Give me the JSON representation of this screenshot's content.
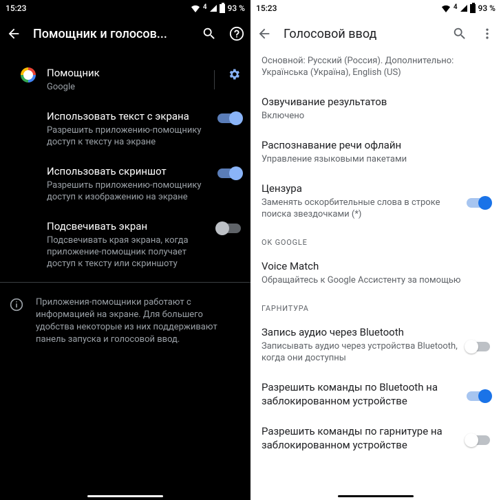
{
  "left": {
    "status": {
      "time": "15:23",
      "net": "4",
      "battery": "93 %"
    },
    "header": {
      "title": "Помощник и голосов..."
    },
    "assistant": {
      "title": "Помощник",
      "subtitle": "Google"
    },
    "items": [
      {
        "title": "Использовать текст с экрана",
        "subtitle": "Разрешить приложению-помощнику доступ к тексту на экране",
        "on": true
      },
      {
        "title": "Использовать скриншот",
        "subtitle": "Разрешить приложению-помощнику доступ к изображению на экране",
        "on": true
      },
      {
        "title": "Подсвечивать экран",
        "subtitle": "Подсвечивать края экрана, когда приложение-помощник получает доступ к тексту или скриншоту",
        "on": false
      }
    ],
    "info": "Приложения-помощники работают с информацией на экране. Для большего удобства некоторые из них поддерживают панель запуска и голосовой ввод."
  },
  "right": {
    "status": {
      "time": "15:23",
      "net": "4",
      "battery": "93 %"
    },
    "header": {
      "title": "Голосовой ввод"
    },
    "lang": {
      "subtitle": "Основной: Русский (Россия). Дополнительно: Українська (Україна), English (US)"
    },
    "items1": [
      {
        "title": "Озвучивание результатов",
        "subtitle": "Включено"
      },
      {
        "title": "Распознавание речи офлайн",
        "subtitle": "Управление языковыми пакетами"
      },
      {
        "title": "Цензура",
        "subtitle": "Заменять оскорбительные слова в строке поиска звездочками (*)",
        "switch": "on"
      }
    ],
    "section_ok": "OK GOOGLE",
    "voice_match": {
      "title": "Voice Match",
      "subtitle": "Обращайтесь к Google Ассистенту за помощью"
    },
    "section_headset": "ГАРНИТУРА",
    "items2": [
      {
        "title": "Запись аудио через Bluetooth",
        "subtitle": "Записывать аудио через устройства Bluetooth, когда они доступны",
        "switch": "off"
      },
      {
        "title": "Разрешить команды по Bluetooth на заблокированном устройстве",
        "switch": "on"
      },
      {
        "title": "Разрешить команды по гарнитуре на заблокированном устройстве",
        "switch": "off"
      }
    ]
  }
}
